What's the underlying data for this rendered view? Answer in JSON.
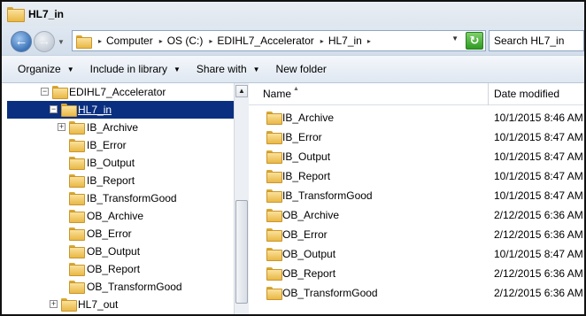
{
  "window": {
    "title": "HL7_in"
  },
  "address": {
    "crumbs": [
      "Computer",
      "OS (C:)",
      "EDIHL7_Accelerator",
      "HL7_in"
    ],
    "search_placeholder": "Search HL7_in"
  },
  "toolbar": {
    "organize": "Organize",
    "include_in_library": "Include in library",
    "share_with": "Share with",
    "new_folder": "New folder"
  },
  "navtree": [
    {
      "label": "EDIHL7_Accelerator",
      "expander": "-",
      "level": 0,
      "selected": false
    },
    {
      "label": "HL7_in",
      "expander": "-",
      "level": 1,
      "selected": true
    },
    {
      "label": "IB_Archive",
      "expander": "+",
      "level": 2,
      "selected": false
    },
    {
      "label": "IB_Error",
      "expander": "",
      "level": 2,
      "selected": false
    },
    {
      "label": "IB_Output",
      "expander": "",
      "level": 2,
      "selected": false
    },
    {
      "label": "IB_Report",
      "expander": "",
      "level": 2,
      "selected": false
    },
    {
      "label": "IB_TransformGood",
      "expander": "",
      "level": 2,
      "selected": false
    },
    {
      "label": "OB_Archive",
      "expander": "",
      "level": 2,
      "selected": false
    },
    {
      "label": "OB_Error",
      "expander": "",
      "level": 2,
      "selected": false
    },
    {
      "label": "OB_Output",
      "expander": "",
      "level": 2,
      "selected": false
    },
    {
      "label": "OB_Report",
      "expander": "",
      "level": 2,
      "selected": false
    },
    {
      "label": "OB_TransformGood",
      "expander": "",
      "level": 2,
      "selected": false
    },
    {
      "label": "HL7_out",
      "expander": "+",
      "level": 1,
      "selected": false
    }
  ],
  "columns": {
    "name": "Name",
    "date_modified": "Date modified"
  },
  "files": [
    {
      "name": "IB_Archive",
      "date": "10/1/2015 8:46 AM"
    },
    {
      "name": "IB_Error",
      "date": "10/1/2015 8:47 AM"
    },
    {
      "name": "IB_Output",
      "date": "10/1/2015 8:47 AM"
    },
    {
      "name": "IB_Report",
      "date": "10/1/2015 8:47 AM"
    },
    {
      "name": "IB_TransformGood",
      "date": "10/1/2015 8:47 AM"
    },
    {
      "name": "OB_Archive",
      "date": "2/12/2015 6:36 AM"
    },
    {
      "name": "OB_Error",
      "date": "2/12/2015 6:36 AM"
    },
    {
      "name": "OB_Output",
      "date": "10/1/2015 8:47 AM"
    },
    {
      "name": "OB_Report",
      "date": "2/12/2015 6:36 AM"
    },
    {
      "name": "OB_TransformGood",
      "date": "2/12/2015 6:36 AM"
    }
  ]
}
